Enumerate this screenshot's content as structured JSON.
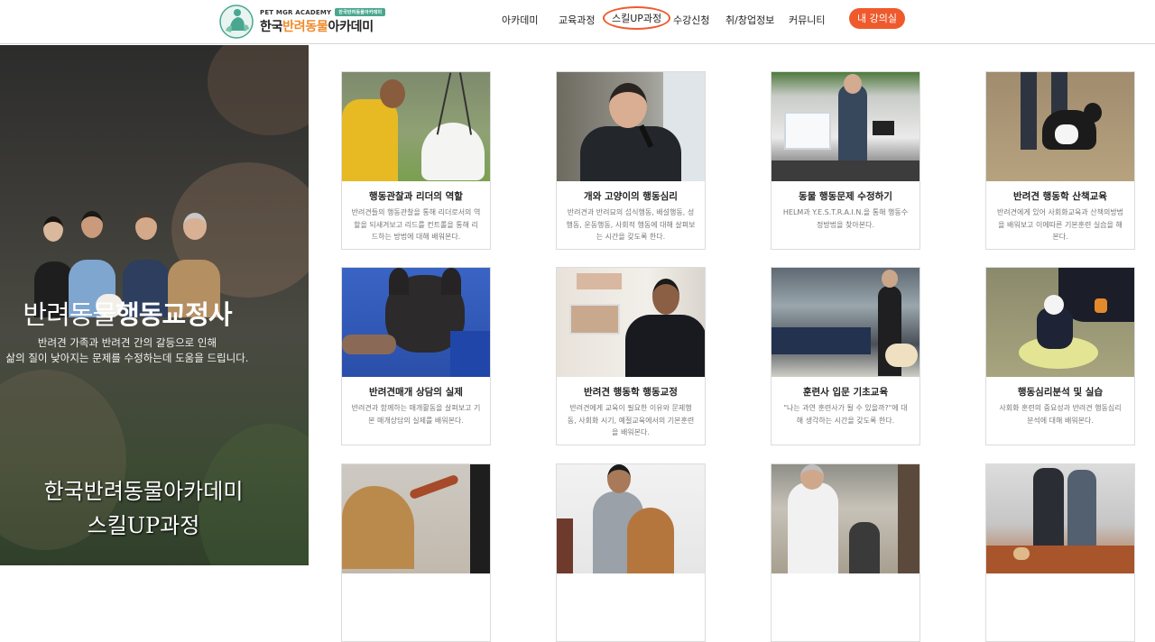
{
  "logo": {
    "top_text": "PET MGR ACADEMY",
    "badge": "한국반려동물아카데미",
    "main_prefix": "한국",
    "main_accent": "반려동물",
    "main_suffix": "아카데미"
  },
  "nav": {
    "items": [
      "아카데미",
      "교육과정",
      "스킬UP과정",
      "수강신청",
      "취/창업정보",
      "커뮤니티"
    ],
    "cta": "내 강의실"
  },
  "hero": {
    "title_light": "반려동물",
    "title_bold": "행동교정사",
    "subtitle_line1": "반려견 가족과 반려견 간의 갈등으로 인해",
    "subtitle_line2": "삶의 질이 낮아지는 문제를 수정하는데 도움을 드립니다.",
    "brand_line1": "한국반려동물아카데미",
    "brand_line2": "스킬UP과정"
  },
  "cards": [
    {
      "title": "행동관찰과 리더의 역할",
      "desc": "반려견들의 행동관찰을 통해 리더로서의 역할을 되새겨보고 리드를 컨트롤을 통해 리드하는 방법에 대해 배워본다."
    },
    {
      "title": "개와 고양이의 행동심리",
      "desc": "반려견과 반려묘의 섭식행동, 배설행동, 성행동, 운동행동, 사회적 행동에 대해 살펴보는 시간을 갖도록 한다."
    },
    {
      "title": "동물 행동문제 수정하기",
      "desc": "HELM과 Y.E.S.T.R.A.I.N.을 통해 행동수정방법을 찾아본다."
    },
    {
      "title": "반려견 행동학 산책교육",
      "desc": "반려견에게 있어 사회화교육과 산책의방법을 배워보고 이에따른 기본훈련 실습을 해본다."
    },
    {
      "title": "반려견매개 상담의 실제",
      "desc": "반려견과 함께하는 매개활동을 살펴보고 기본 매개상담의 실제를 배워본다."
    },
    {
      "title": "반려견 행동학 행동교정",
      "desc": "반려견에게 교육이 필요한 이유와 문제행동, 사회화 시기, 예절교육에서의 기본훈련을 배워본다."
    },
    {
      "title": "훈련사 입문 기초교육",
      "desc": "\"나는 과연 훈련사가 될 수 있을까?\"에 대해 생각하는 시간을 갖도록 한다."
    },
    {
      "title": "행동심리분석 및 실습",
      "desc": "사회화 훈련의 중요성과 반려견 행동심리 분석에 대해 배워본다."
    },
    {
      "title": "",
      "desc": ""
    },
    {
      "title": "",
      "desc": ""
    },
    {
      "title": "",
      "desc": ""
    },
    {
      "title": "",
      "desc": ""
    }
  ],
  "colors": {
    "accent": "#ef5a2c",
    "logo_accent": "#f08a2c",
    "logo_green": "#4aa78f"
  }
}
